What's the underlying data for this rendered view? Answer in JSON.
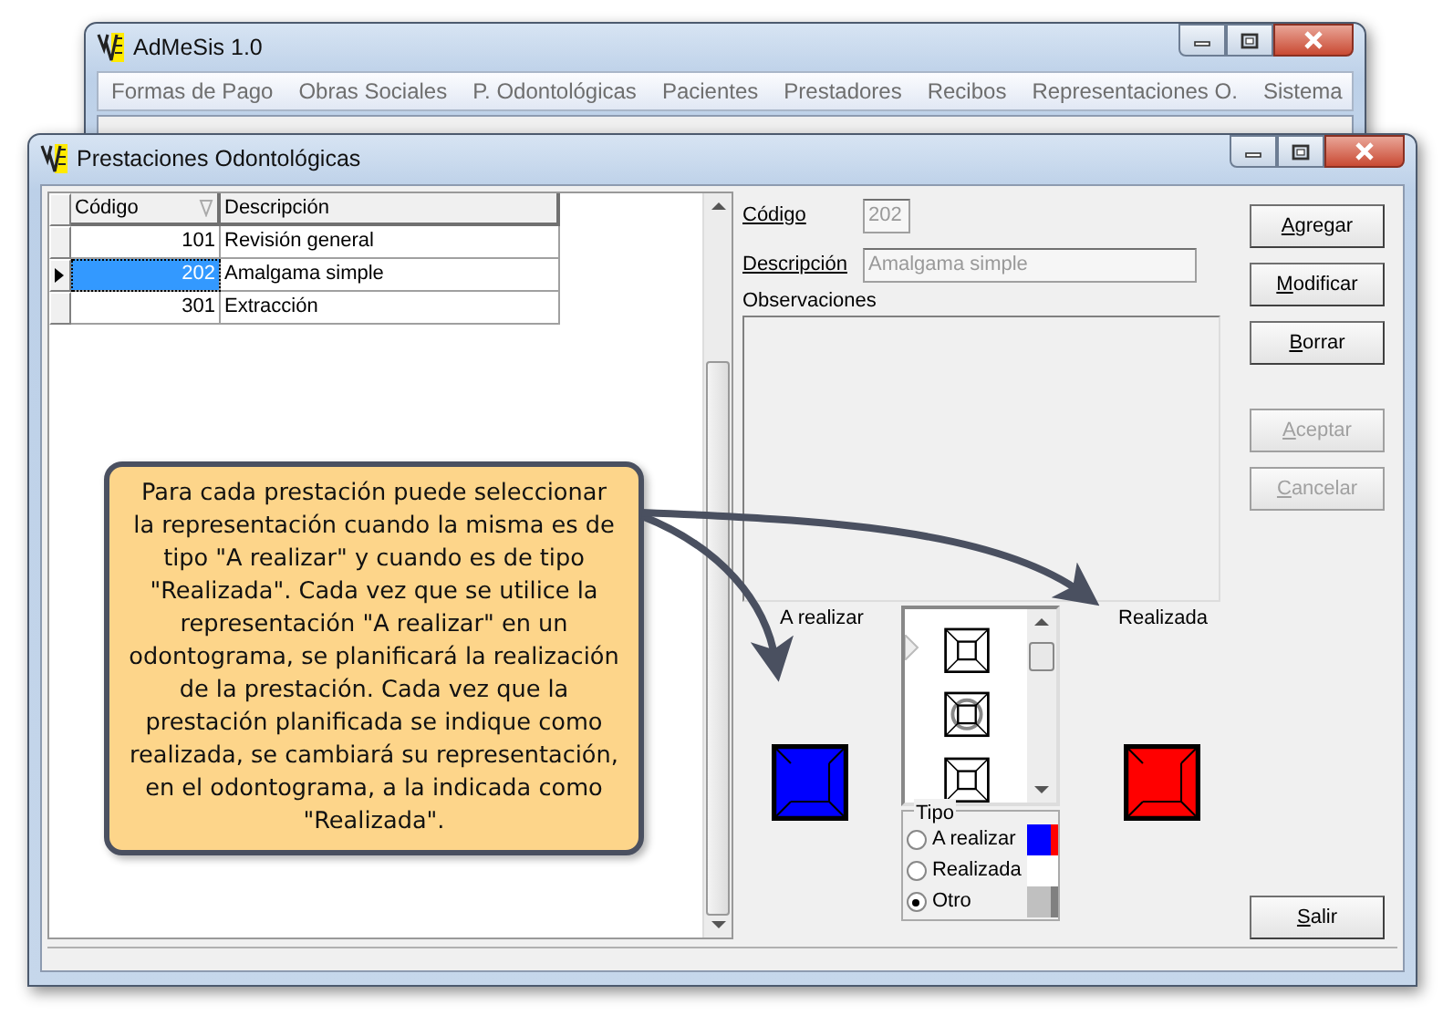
{
  "main_window": {
    "title": "AdMeSis 1.0",
    "menu": [
      "Formas de Pago",
      "Obras Sociales",
      "P. Odontológicas",
      "Pacientes",
      "Prestadores",
      "Recibos",
      "Representaciones O.",
      "Sistema"
    ]
  },
  "dialog": {
    "title": "Prestaciones Odontológicas",
    "grid": {
      "columns": [
        "Código",
        "Descripción"
      ],
      "rows": [
        {
          "code": "101",
          "description": "Revisión general",
          "selected": false
        },
        {
          "code": "202",
          "description": "Amalgama simple",
          "selected": true
        },
        {
          "code": "301",
          "description": "Extracción",
          "selected": false
        }
      ]
    },
    "form": {
      "code_label": "Código",
      "code_value": "202",
      "description_label": "Descripción",
      "description_value": "Amalgama simple",
      "notes_label": "Observaciones"
    },
    "buttons": [
      {
        "label": "Agregar",
        "disabled": false
      },
      {
        "label": "Modificar",
        "disabled": false
      },
      {
        "label": "Borrar",
        "disabled": false
      },
      {
        "label": "Aceptar",
        "disabled": true
      },
      {
        "label": "Cancelar",
        "disabled": true
      }
    ],
    "exit_button": {
      "label": "Salir",
      "disabled": false
    },
    "to_do_label": "A realizar",
    "done_label": "Realizada",
    "type_group": {
      "title": "Tipo",
      "options": [
        {
          "label": "A realizar",
          "selected": false,
          "kind": "todo"
        },
        {
          "label": "Realizada",
          "selected": false,
          "kind": "done"
        },
        {
          "label": "Otro",
          "selected": true,
          "kind": "other"
        }
      ]
    }
  },
  "callout": {
    "text": "Para cada prestación puede seleccionar la representación cuando la misma es de tipo \"A realizar\" y cuando es de tipo \"Realizada\". Cada vez que se utilice la representación \"A realizar\" en un odontograma, se planificará la realización de la prestación. Cada vez que la prestación planificada se indique como realizada, se cambiará su representación, en el odontograma, a la indicada como \"Realizada\"."
  }
}
